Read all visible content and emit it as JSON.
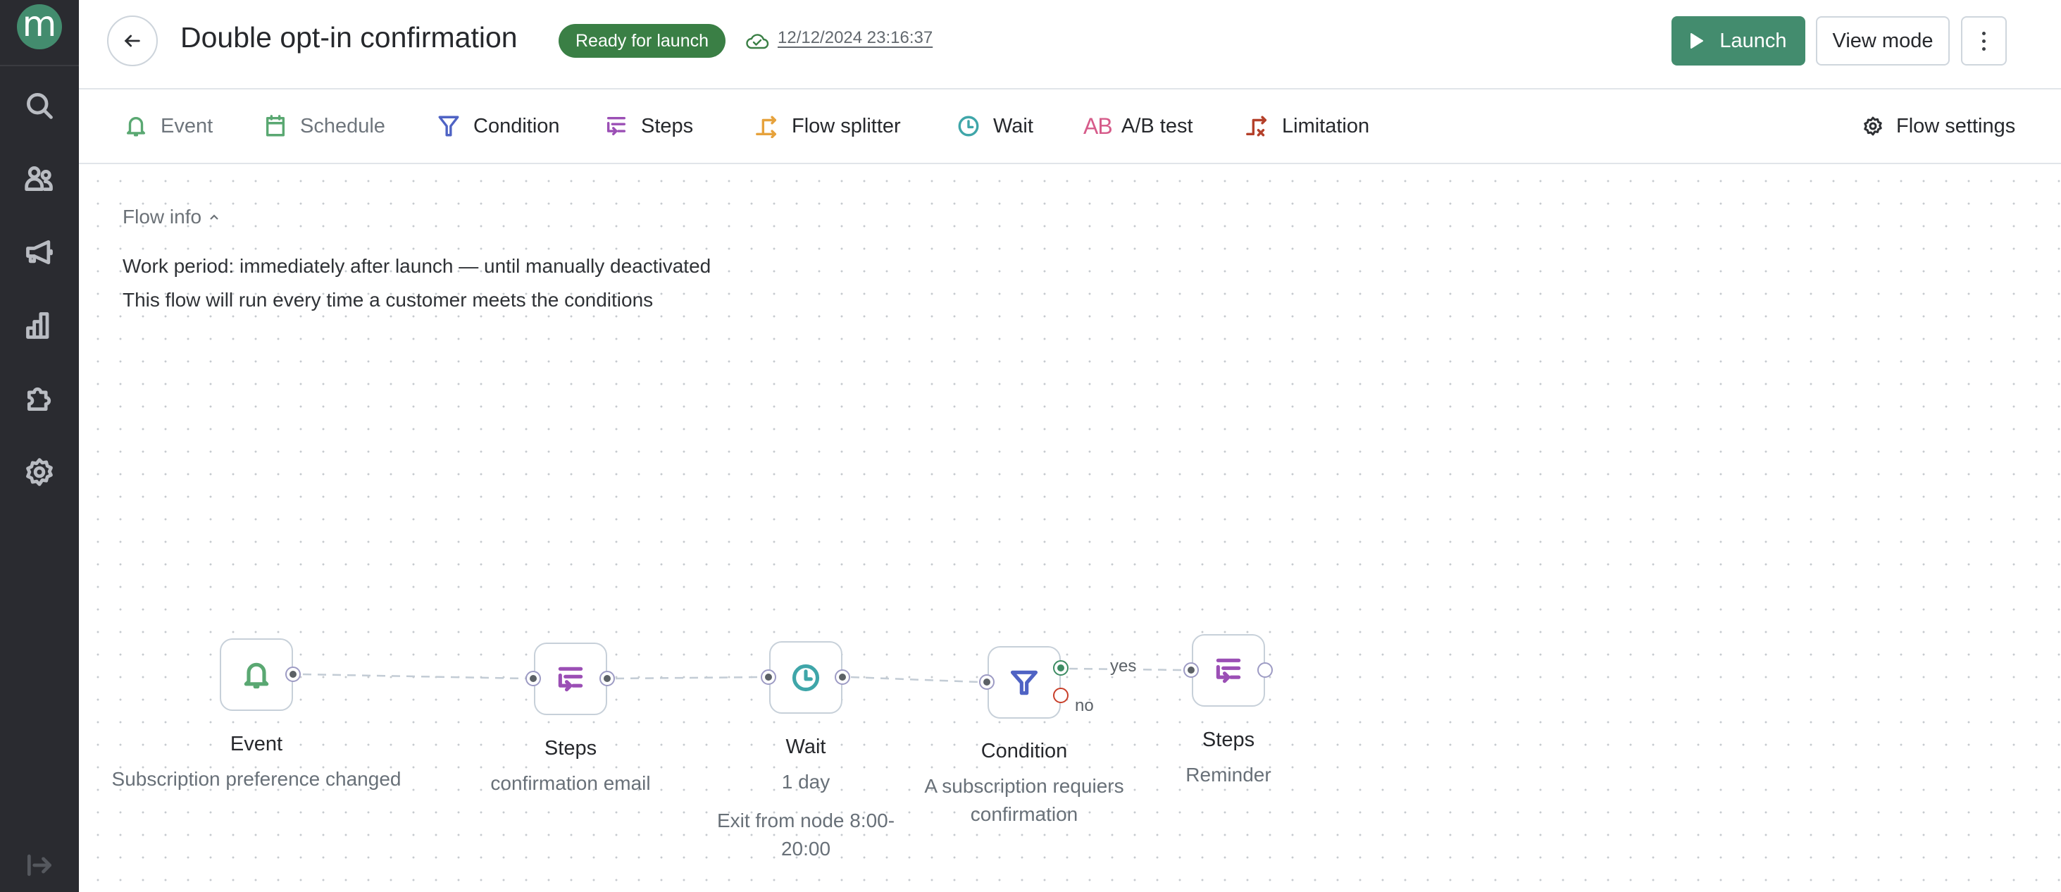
{
  "sidebar": {
    "logo": "m",
    "items": [
      {
        "name": "search",
        "icon": "search-icon"
      },
      {
        "name": "customers",
        "icon": "users-icon"
      },
      {
        "name": "campaigns",
        "icon": "megaphone-icon"
      },
      {
        "name": "analytics",
        "icon": "bar-chart-icon"
      },
      {
        "name": "integrations",
        "icon": "puzzle-icon"
      },
      {
        "name": "settings",
        "icon": "gear-icon"
      }
    ],
    "expand_icon": "expand-sidebar-icon"
  },
  "header": {
    "title": "Double opt-in confirmation",
    "status_badge": "Ready for launch",
    "saved_at": "12/12/2024 23:16:37",
    "launch_label": "Launch",
    "view_mode_label": "View mode"
  },
  "toolbar": {
    "items": [
      {
        "label": "Event",
        "icon": "bell-icon",
        "color": "#5aa872",
        "disabled": true
      },
      {
        "label": "Schedule",
        "icon": "calendar-icon",
        "color": "#5aa872",
        "disabled": true
      },
      {
        "label": "Condition",
        "icon": "filter-icon",
        "color": "#4f63c4",
        "disabled": false
      },
      {
        "label": "Steps",
        "icon": "steps-icon",
        "color": "#9b4fb5",
        "disabled": false
      },
      {
        "label": "Flow splitter",
        "icon": "flow-splitter-icon",
        "color": "#e6a23c",
        "disabled": false
      },
      {
        "label": "Wait",
        "icon": "clock-icon",
        "color": "#3fa6a9",
        "disabled": false
      },
      {
        "label": "A/B test",
        "icon": "ab-icon",
        "icon_text": "AB",
        "color": "#d65b8a",
        "disabled": false
      },
      {
        "label": "Limitation",
        "icon": "limitation-icon",
        "color": "#b4402a",
        "disabled": false
      }
    ],
    "flow_settings_label": "Flow settings"
  },
  "flow_info": {
    "toggle_label": "Flow info",
    "work_period": "Work period: immediately after launch — until manually deactivated",
    "run_rule": "This flow will run every time a customer meets the conditions"
  },
  "nodes": [
    {
      "id": "event",
      "type": "Event",
      "title": "Event",
      "subtitle": [
        "Subscription preference changed"
      ],
      "color": "#5aa872"
    },
    {
      "id": "steps1",
      "type": "Steps",
      "title": "Steps",
      "subtitle": [
        "confirmation email"
      ],
      "color": "#9b4fb5"
    },
    {
      "id": "wait",
      "type": "Wait",
      "title": "Wait",
      "subtitle": [
        "1 day",
        "Exit from node 8:00-",
        "20:00"
      ],
      "color": "#3fa6a9"
    },
    {
      "id": "condition",
      "type": "Condition",
      "title": "Condition",
      "subtitle": [
        "A subscription requiers",
        "confirmation"
      ],
      "color": "#4f63c4"
    },
    {
      "id": "steps2",
      "type": "Steps",
      "title": "Steps",
      "subtitle": [
        "Reminder"
      ],
      "color": "#9b4fb5"
    }
  ],
  "edges": [
    {
      "from": "event",
      "to": "steps1"
    },
    {
      "from": "steps1",
      "to": "wait"
    },
    {
      "from": "wait",
      "to": "condition"
    },
    {
      "from": "condition",
      "to": "steps2",
      "label": "yes"
    }
  ],
  "condition_branches": {
    "yes": "yes",
    "no": "no"
  },
  "colors": {
    "brand": "#438c6e",
    "ready_badge": "#3a7f45",
    "sidebar_bg": "#2a2b30",
    "yes_port": "#3d8c63",
    "no_port": "#c83f2a"
  }
}
